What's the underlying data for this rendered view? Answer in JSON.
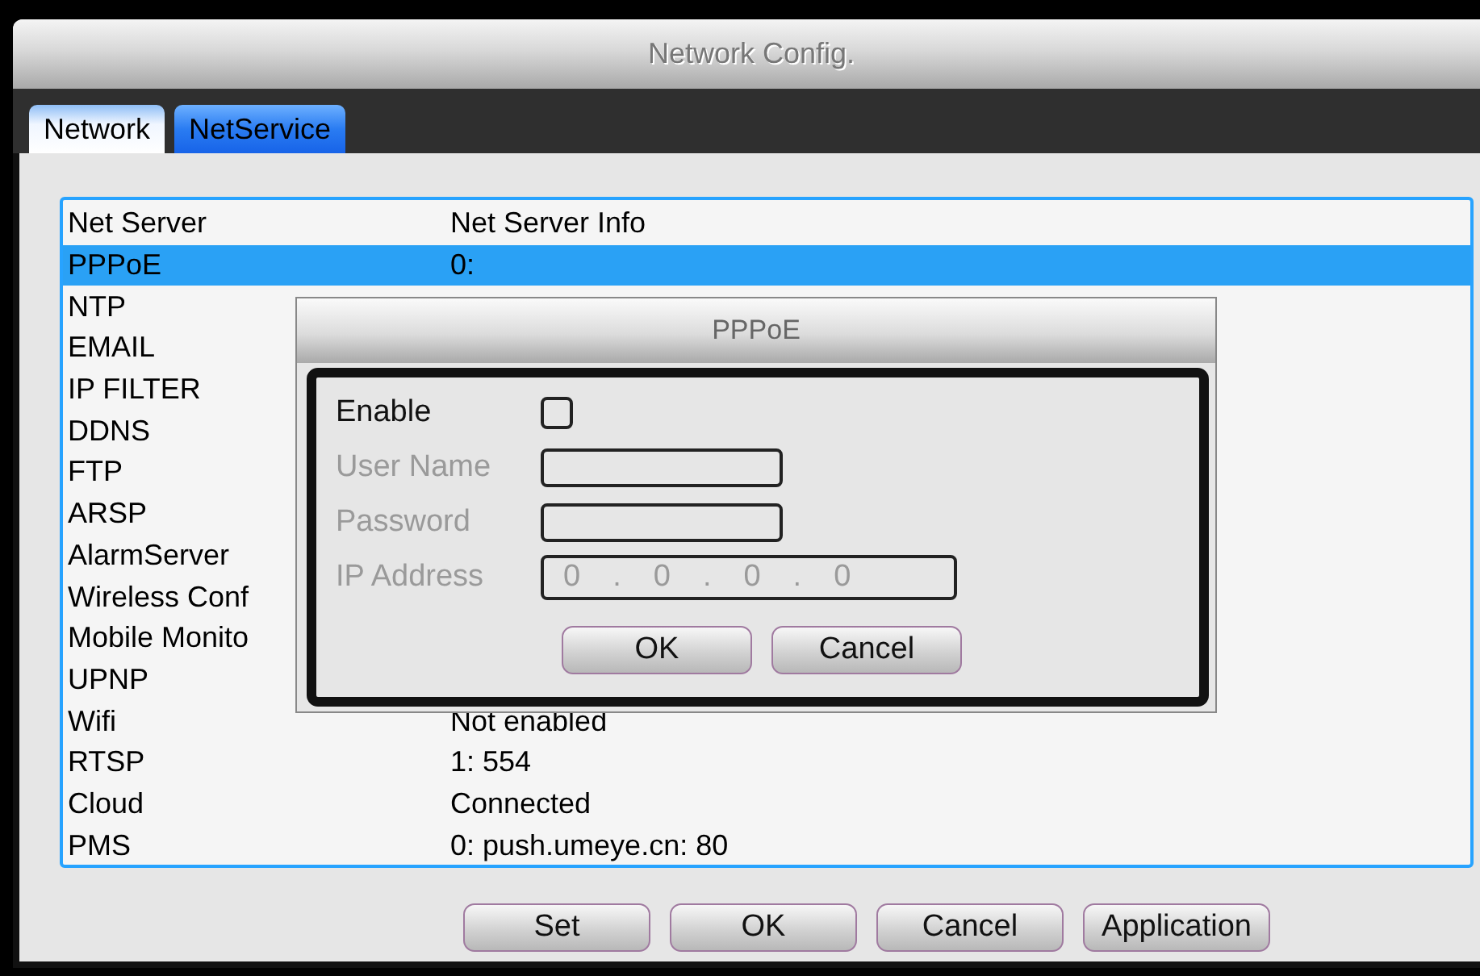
{
  "window": {
    "title": "Network Config."
  },
  "tabs": [
    {
      "label": "Network",
      "selected": false
    },
    {
      "label": "NetService",
      "selected": true
    }
  ],
  "table": {
    "columns": [
      "Net Server",
      "Net Server Info"
    ],
    "rows": [
      {
        "server": "PPPoE",
        "info": "0:",
        "selected": true
      },
      {
        "server": "NTP",
        "selected": false
      },
      {
        "server": "EMAIL",
        "selected": false
      },
      {
        "server": "IP FILTER",
        "selected": false
      },
      {
        "server": "DDNS",
        "selected": false
      },
      {
        "server": "FTP",
        "selected": false
      },
      {
        "server": "ARSP",
        "selected": false
      },
      {
        "server": "AlarmServer",
        "selected": false
      },
      {
        "server": "Wireless Conf",
        "selected": false
      },
      {
        "server": "Mobile Monito",
        "selected": false
      },
      {
        "server": "UPNP",
        "selected": false
      },
      {
        "server": "Wifi",
        "info": "Not enabled",
        "selected": false
      },
      {
        "server": "RTSP",
        "info": "1: 554",
        "selected": false
      },
      {
        "server": "Cloud",
        "info": "Connected",
        "selected": false
      },
      {
        "server": "PMS",
        "info": "0: push.umeye.cn: 80",
        "selected": false
      }
    ]
  },
  "dialog": {
    "title": "PPPoE",
    "fields": [
      {
        "kind": "checkbox",
        "label": "Enable",
        "checked": false,
        "disabled": false
      },
      {
        "kind": "text",
        "label": "User Name",
        "disabled": true
      },
      {
        "kind": "text",
        "label": "Password",
        "disabled": true
      },
      {
        "kind": "ip",
        "label": "IP Address",
        "octets": [
          "0",
          "0",
          "0",
          "0"
        ],
        "separator": ".",
        "disabled": true
      }
    ],
    "buttons": [
      "OK",
      "Cancel"
    ]
  },
  "buttons": [
    "Set",
    "OK",
    "Cancel",
    "Application"
  ]
}
